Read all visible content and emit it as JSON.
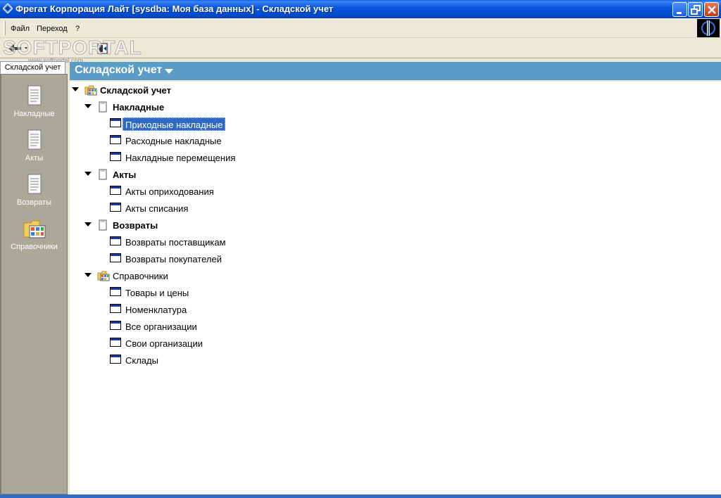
{
  "window": {
    "title": "Фрегат Корпорация Лайт [sysdba: Моя база данных] - Складской учет",
    "title_color": "#0a56dc"
  },
  "menu": {
    "file": "Файл",
    "go": "Переход",
    "help": "?"
  },
  "watermark": {
    "text": "SOFTPORTAL",
    "sub": "www.softportal.com"
  },
  "nav": {
    "tab_label": "Складской учет",
    "items": [
      {
        "label": "Накладные",
        "icon": "document-icon"
      },
      {
        "label": "Акты",
        "icon": "document-icon"
      },
      {
        "label": "Возвраты",
        "icon": "document-icon"
      },
      {
        "label": "Справочники",
        "icon": "folder-grid-icon"
      }
    ]
  },
  "header": {
    "title": "Складской учет",
    "bg_color": "#5b9cc6"
  },
  "tree": {
    "root": "Складской учет",
    "groups": [
      {
        "label": "Накладные",
        "items": [
          "Приходные накладные",
          "Расходные накладные",
          "Накладные перемещения"
        ]
      },
      {
        "label": "Акты",
        "items": [
          "Акты оприходования",
          "Акты списания"
        ]
      },
      {
        "label": "Возвраты",
        "items": [
          "Возвраты поставщикам",
          "Возвраты покупателей"
        ]
      },
      {
        "label": "Справочники",
        "items": [
          "Товары и цены",
          "Номенклатура",
          "Все организации",
          "Свои организации",
          "Склады"
        ]
      }
    ],
    "selected": "Приходные накладные",
    "selection_color": "#316ac5"
  }
}
